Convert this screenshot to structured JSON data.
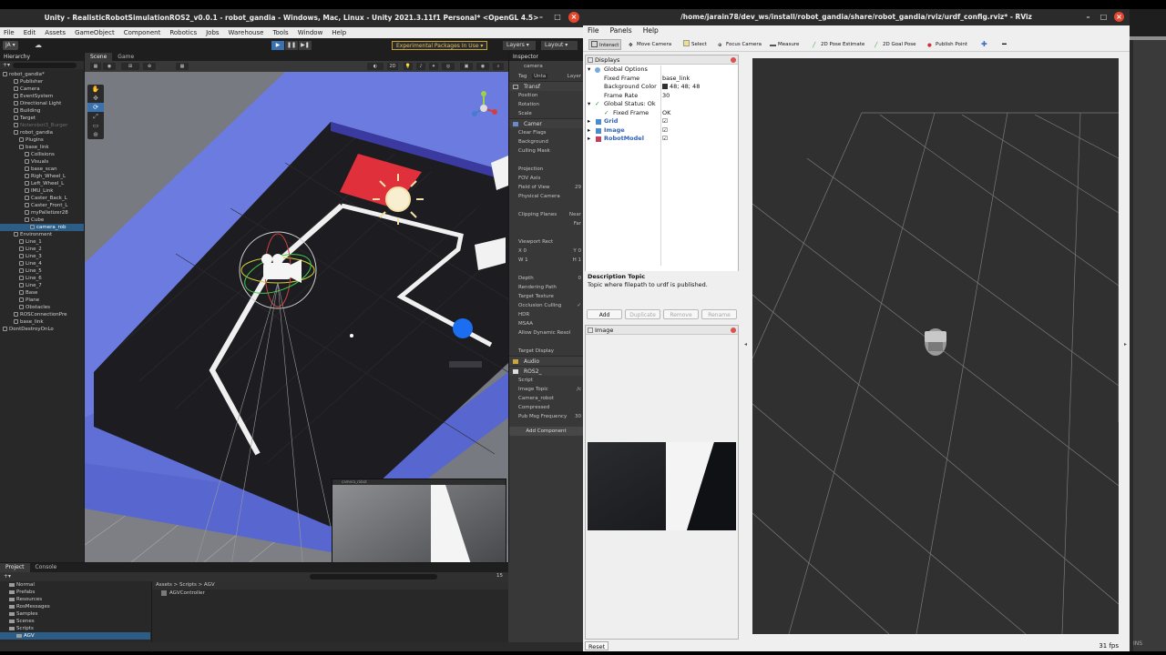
{
  "unity": {
    "title": "Unity - RealisticRobotSimulationROS2_v0.0.1 - robot_gandia - Windows, Mac, Linux - Unity 2021.3.11f1 Personal* <OpenGL 4.5>",
    "menu": [
      "File",
      "Edit",
      "Assets",
      "GameObject",
      "Component",
      "Robotics",
      "Jobs",
      "Warehouse",
      "Tools",
      "Window",
      "Help"
    ],
    "account": "JA ▾",
    "experimental": "Experimental Packages In Use ▾",
    "layers": "Layers ▾",
    "layout": "Layout ▾",
    "hierarchy": {
      "tab": "Hierarchy",
      "items": [
        {
          "label": "robot_gandia*",
          "indent": 0
        },
        {
          "label": "Publisher",
          "indent": 2
        },
        {
          "label": "Camera",
          "indent": 2
        },
        {
          "label": "EventSystem",
          "indent": 2
        },
        {
          "label": "Directional Light",
          "indent": 2
        },
        {
          "label": "Building",
          "indent": 2
        },
        {
          "label": "Target",
          "indent": 2
        },
        {
          "label": "Noterobot3_Burger",
          "indent": 2
        },
        {
          "label": "robot_gandia",
          "indent": 2
        },
        {
          "label": "Plugins",
          "indent": 3
        },
        {
          "label": "base_link",
          "indent": 3
        },
        {
          "label": "Collisions",
          "indent": 4
        },
        {
          "label": "Visuals",
          "indent": 4
        },
        {
          "label": "base_scan",
          "indent": 4
        },
        {
          "label": "Righ_Wheel_L",
          "indent": 4
        },
        {
          "label": "Left_Wheel_L",
          "indent": 4
        },
        {
          "label": "IMU_Link",
          "indent": 4
        },
        {
          "label": "Caster_Back_L",
          "indent": 4
        },
        {
          "label": "Caster_Front_L",
          "indent": 4
        },
        {
          "label": "myPalletizer28",
          "indent": 4
        },
        {
          "label": "Cube",
          "indent": 4
        },
        {
          "label": "camera_rob",
          "indent": 5
        },
        {
          "label": "Environment",
          "indent": 2
        },
        {
          "label": "Line_1",
          "indent": 3
        },
        {
          "label": "Line_2",
          "indent": 3
        },
        {
          "label": "Line_3",
          "indent": 3
        },
        {
          "label": "Line_4",
          "indent": 3
        },
        {
          "label": "Line_5",
          "indent": 3
        },
        {
          "label": "Line_6",
          "indent": 3
        },
        {
          "label": "Line_7",
          "indent": 3
        },
        {
          "label": "Base",
          "indent": 3
        },
        {
          "label": "Plane",
          "indent": 3
        },
        {
          "label": "Obstacles",
          "indent": 3
        },
        {
          "label": "ROSConnectionPre",
          "indent": 2
        },
        {
          "label": "base_link",
          "indent": 2
        },
        {
          "label": "DontDestroyOnLo",
          "indent": 0
        }
      ]
    },
    "scene": {
      "tabs": [
        "Scene",
        "Game"
      ],
      "pip_label": "camera_robot"
    },
    "inspector": {
      "tab": "Inspector",
      "object_name": "camera",
      "tag_label": "Tag",
      "tag_value": "Unta",
      "layer_label": "Layer",
      "transform": "Transf",
      "transform_rows": [
        "Position",
        "Rotation",
        "Scale"
      ],
      "camera": "Camer",
      "camera_rows": [
        {
          "label": "Clear Flags",
          "val": ""
        },
        {
          "label": "Background",
          "val": ""
        },
        {
          "label": "Culling Mask",
          "val": ""
        },
        {
          "label": "",
          "val": ""
        },
        {
          "label": "Projection",
          "val": ""
        },
        {
          "label": "FOV Axis",
          "val": ""
        },
        {
          "label": "Field of View",
          "val": "29"
        },
        {
          "label": "Physical Camera",
          "val": ""
        },
        {
          "label": "",
          "val": ""
        },
        {
          "label": "Clipping Planes",
          "val": "Near"
        },
        {
          "label": "",
          "val": "Far"
        },
        {
          "label": "",
          "val": ""
        },
        {
          "label": "Viewport Rect",
          "val": ""
        },
        {
          "label": "X 0",
          "val": "Y 0"
        },
        {
          "label": "W 1",
          "val": "H 1"
        },
        {
          "label": "",
          "val": ""
        },
        {
          "label": "Depth",
          "val": "0"
        },
        {
          "label": "Rendering Path",
          "val": ""
        },
        {
          "label": "Target Texture",
          "val": ""
        },
        {
          "label": "Occlusion Culling",
          "val": "✓"
        },
        {
          "label": "HDR",
          "val": ""
        },
        {
          "label": "MSAA",
          "val": ""
        },
        {
          "label": "Allow Dynamic Resol",
          "val": ""
        },
        {
          "label": "",
          "val": ""
        },
        {
          "label": "Target Display",
          "val": ""
        }
      ],
      "audio": "Audio",
      "ros2": "ROS2_",
      "ros2_rows": [
        {
          "label": "Script",
          "val": ""
        },
        {
          "label": "Image Topic",
          "val": "/c"
        },
        {
          "label": "Camera_robot",
          "val": ""
        },
        {
          "label": "Compressed",
          "val": ""
        },
        {
          "label": "Pub Msg Frequency",
          "val": "30"
        }
      ],
      "add_component": "Add Component"
    },
    "project": {
      "tabs": [
        "Project",
        "Console"
      ],
      "folders": [
        "Normal",
        "Prefabs",
        "Resources",
        "RosMessages",
        "Samples",
        "Scenes",
        "Scripts",
        "AGV"
      ],
      "breadcrumb": "Assets  >  Scripts  >  AGV",
      "assets": [
        "AGVController"
      ],
      "count": "15"
    }
  },
  "rviz": {
    "title": "/home/jarain78/dev_ws/install/robot_gandia/share/robot_gandia/rviz/urdf_config.rviz* - RViz",
    "menu": [
      "File",
      "Panels",
      "Help"
    ],
    "tools": [
      "Interact",
      "Move Camera",
      "Select",
      "Focus Camera",
      "Measure",
      "2D Pose Estimate",
      "2D Goal Pose",
      "Publish Point"
    ],
    "displays": {
      "title": "Displays",
      "global_options": "Global Options",
      "fixed_frame_label": "Fixed Frame",
      "fixed_frame_value": "base_link",
      "bg_color_label": "Background Color",
      "bg_color_value": "48; 48; 48",
      "frame_rate_label": "Frame Rate",
      "frame_rate_value": "30",
      "global_status": "Global Status: Ok",
      "gs_fixed_frame": "Fixed Frame",
      "gs_fixed_frame_value": "OK",
      "items": [
        "Grid",
        "Image",
        "RobotModel"
      ]
    },
    "description": {
      "title": "Description Topic",
      "body": "Topic where filepath to urdf is published."
    },
    "buttons": [
      "Add",
      "Duplicate",
      "Remove",
      "Rename"
    ],
    "image_panel": "Image",
    "reset": "Reset",
    "fps": "31 fps",
    "colors": {
      "viewport_bg": "#303030",
      "accent_red": "#e03b3b"
    }
  },
  "side": {
    "ins": "INS"
  }
}
